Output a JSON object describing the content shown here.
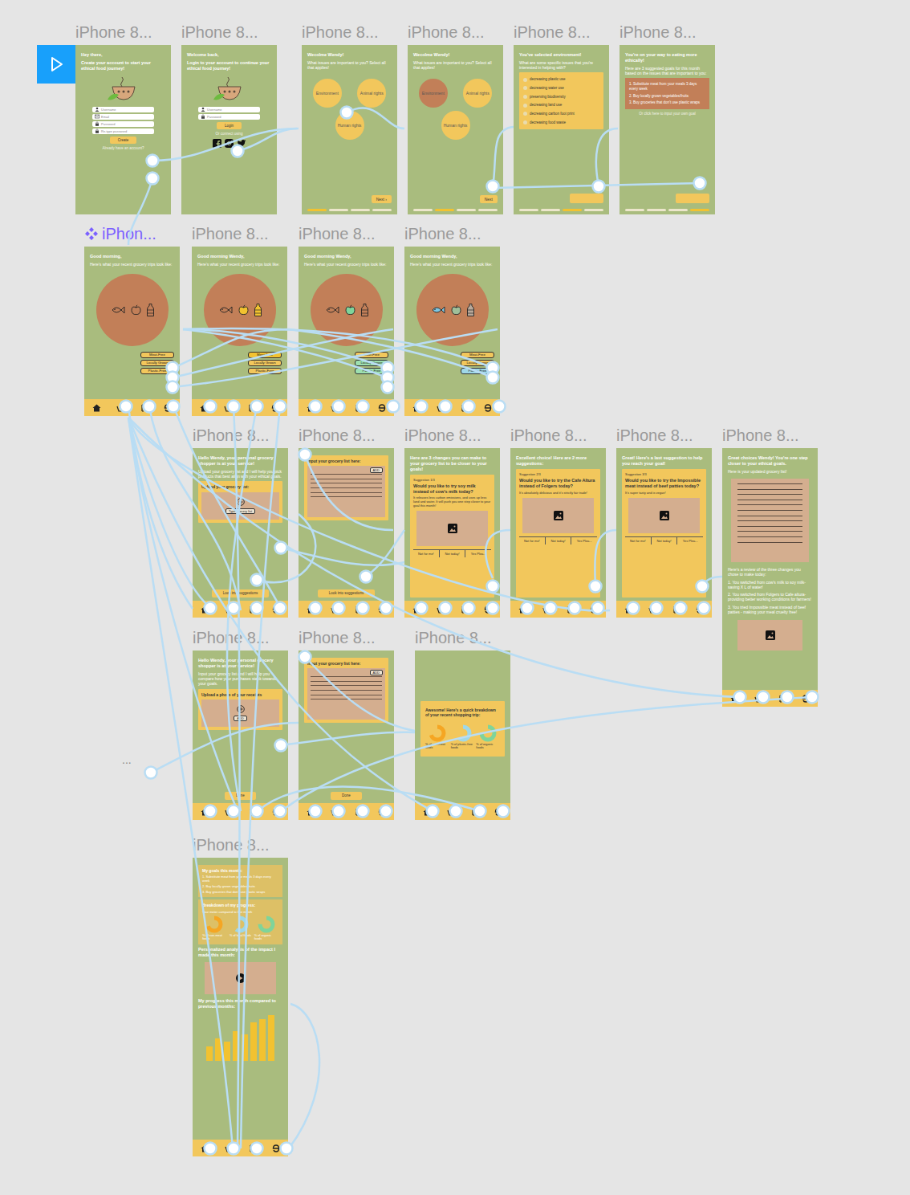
{
  "canvas": {
    "more": "..."
  },
  "frames": [
    {
      "title": "iPhone 8...",
      "component": false,
      "kind": "signup",
      "heading": "Hey there,",
      "subheading": "Create your account to start your ethical food journey!",
      "fields": [
        {
          "kind": "user",
          "placeholder": "Username"
        },
        {
          "kind": "mail",
          "placeholder": "Email"
        },
        {
          "kind": "lock",
          "placeholder": "Password"
        },
        {
          "kind": "lock",
          "placeholder": "Re-type password"
        }
      ],
      "button": "Create",
      "link": "Already have an account?"
    },
    {
      "title": "iPhone 8...",
      "component": false,
      "kind": "login",
      "heading": "Welcome back,",
      "subheading": "Login to your account to continue your ethical food journey!",
      "fields": [
        {
          "kind": "user",
          "placeholder": "Username"
        },
        {
          "kind": "lock",
          "placeholder": "Password"
        }
      ],
      "button": "Login",
      "connect": "Or connect using"
    },
    {
      "title": "iPhone 8...",
      "component": false,
      "kind": "issues",
      "heading": "Wecolme Wendy!",
      "question": "What issues are important to you? Select all that applies!",
      "issues": [
        {
          "label": "Environment",
          "selected": false
        },
        {
          "label": "Animal rights",
          "selected": false
        },
        {
          "label": "Human rights",
          "selected": false
        }
      ],
      "button": "Next",
      "chevron": "›",
      "progress": [
        {
          "selected": true
        },
        {
          "selected": false
        },
        {
          "selected": false
        },
        {
          "selected": false
        }
      ]
    },
    {
      "title": "iPhone 8...",
      "component": false,
      "kind": "issues",
      "heading": "Wecolme Wendy!",
      "question": "What issues are important to you? Select all that applies!",
      "issues": [
        {
          "label": "Environment",
          "selected": true
        },
        {
          "label": "Animal rights",
          "selected": false
        },
        {
          "label": "Human rights",
          "selected": false
        }
      ],
      "button": "Next",
      "chevron": "",
      "progress": [
        {
          "selected": false
        },
        {
          "selected": true
        },
        {
          "selected": false
        },
        {
          "selected": false
        }
      ]
    },
    {
      "title": "iPhone 8...",
      "component": false,
      "kind": "checklist",
      "heading": "You've selected environment!",
      "question": "What are some specific issues that you're interested in helping with?",
      "items": [
        {
          "label": "decreasing plastic use",
          "checked": false
        },
        {
          "label": "decreasing water use",
          "checked": false
        },
        {
          "label": "preserving biodiversity",
          "checked": false
        },
        {
          "label": "decreasing land use",
          "checked": false
        },
        {
          "label": "decreasing carbon foot print",
          "checked": false
        },
        {
          "label": "decreasing food waste",
          "checked": false
        }
      ],
      "progress": [
        {
          "selected": false
        },
        {
          "selected": false
        },
        {
          "selected": true
        },
        {
          "selected": false
        }
      ]
    },
    {
      "title": "iPhone 8...",
      "component": false,
      "kind": "goals",
      "heading": "You're on your way to eating more ethically!",
      "intro": "Here are 3 suggested goals for this month based on the issues that are important to you:",
      "goals": [
        "1. Substitute meat from your meals 3 days every week",
        "2. Buy locally grown vegetables/fruits",
        "3. Buy groceries that don't use plastic wraps"
      ],
      "note": "Or click here to input your own goal",
      "progress": [
        {
          "selected": false
        },
        {
          "selected": false
        },
        {
          "selected": false
        },
        {
          "selected": true
        }
      ]
    },
    {
      "title": "iPhon...",
      "component": true,
      "kind": "home",
      "greeting": "Good morning,",
      "subtitle": "Here's what your recent grocery trips look like:",
      "foods": [
        {
          "kind": "fish",
          "color": "#c27f58"
        },
        {
          "kind": "apple",
          "color": "#c27f58"
        },
        {
          "kind": "bottle",
          "color": "#c27f58"
        }
      ],
      "filters": [
        {
          "label": "Meat-Free",
          "color": "#f2c75c"
        },
        {
          "label": "Locally Grown",
          "color": "#f2c75c"
        },
        {
          "label": "Plastic-Free",
          "color": "#f2c75c"
        }
      ]
    },
    {
      "title": "iPhone 8...",
      "component": false,
      "kind": "home",
      "greeting": "Good morning Wendy,",
      "subtitle": "Here's what your recent grocery trips look like:",
      "foods": [
        {
          "kind": "fish",
          "color": "#c27f58"
        },
        {
          "kind": "apple",
          "color": "#f2c230"
        },
        {
          "kind": "bottle",
          "color": "#f2c230"
        }
      ],
      "filters": [
        {
          "label": "Meat-Free",
          "color": "#f2c230"
        },
        {
          "label": "Locally Grown",
          "color": "#f2c75c"
        },
        {
          "label": "Plastic-Free",
          "color": "#f2c75c"
        }
      ]
    },
    {
      "title": "iPhone 8...",
      "component": false,
      "kind": "home",
      "greeting": "Good morning Wendy,",
      "subtitle": "Here's what your recent grocery trips look like:",
      "foods": [
        {
          "kind": "fish",
          "color": "#c27f58"
        },
        {
          "kind": "apple",
          "color": "#7fd49a"
        },
        {
          "kind": "bottle",
          "color": "#c27f58"
        }
      ],
      "filters": [
        {
          "label": "Meat-Free",
          "color": "#f2c75c"
        },
        {
          "label": "Locally Grown",
          "color": "#9de0b0"
        },
        {
          "label": "Plastic-Free",
          "color": "#9de0b0"
        }
      ]
    },
    {
      "title": "iPhone 8...",
      "component": false,
      "kind": "home",
      "greeting": "Good morning Wendy,",
      "subtitle": "Here's what your recent grocery trips look like:",
      "foods": [
        {
          "kind": "fish",
          "color": "#7ec8e3"
        },
        {
          "kind": "apple",
          "color": "#9fbf9a"
        },
        {
          "kind": "bottle",
          "color": "#b9a99a"
        }
      ],
      "filters": [
        {
          "label": "Meat-Free",
          "color": "#f2c75c"
        },
        {
          "label": "Locally Grown",
          "color": "#f2c75c"
        },
        {
          "label": "Plastic-Free",
          "color": "#9fd8e8"
        }
      ]
    },
    {
      "title": "iPhone 8...",
      "component": false,
      "kind": "upload",
      "intro": "Hello Wendy, your personal grocery shopper is at your service!",
      "body": "Upload your grocery list and I will help you pick products that best align with your ethical goals.",
      "card": "Upload your grocery list:",
      "drop": "Type grocery list",
      "button": "Look into suggestions"
    },
    {
      "title": "iPhone 8...",
      "component": false,
      "kind": "input",
      "card": "Input your grocery list here:",
      "add": "ADD",
      "button": "Look into suggestions"
    },
    {
      "title": "iPhone 8...",
      "component": false,
      "kind": "suggestion",
      "intro": "Here are 3 changes you can make to your grocery list to be closer to your goals!",
      "label": "Suggestion 1/3",
      "question": "Would you like to try soy milk instead of cow's milk today?",
      "detail": "It releases less carbon emissions, and uses up less land and water. It will push you one step closer to your goal this month!",
      "choices": [
        "Not for me!",
        "Not today!",
        "Yes Plea..."
      ]
    },
    {
      "title": "iPhone 8...",
      "component": false,
      "kind": "suggestion",
      "intro": "Excellent choice! Here are 2 more suggestions:",
      "label": "Suggestion 2/3",
      "question": "Would you like to try the Cafe Altura instead of Folgers today?",
      "detail": "It's absolutely delicious and it's strictly fair trade!",
      "choices": [
        "Not for me!",
        "Not today!",
        "Yes Plea..."
      ]
    },
    {
      "title": "iPhone 8...",
      "component": false,
      "kind": "suggestion",
      "intro": "Great! Here's a last suggestion to help you reach your goal!",
      "label": "Suggestion 3/3",
      "question": "Would you like to try the Impossible meat instead of beef patties today?",
      "detail": "It's super tasty and is vegan!",
      "choices": [
        "Not for me!",
        "Not today!",
        "Yes Plea..."
      ]
    },
    {
      "title": "iPhone 8...",
      "component": false,
      "kind": "summary",
      "intro": "Great choices Wendy! You're one step closer to your ethical goals.",
      "sub": "Here is your updated grocery list!",
      "review": "Here's a review of the three changes you chose to make today:",
      "changes": [
        "1. You switched from cow's milk to soy milk- saving X L of water!",
        "2. You switched from Folgers to Cafe altura- providing better working conditions for farmers!",
        "3. You tried Impossible meat instead of beef patties - making your meal cruelty free!"
      ]
    },
    {
      "title": "iPhone 8...",
      "component": false,
      "kind": "upload",
      "intro": "Hello Wendy, your personal grocery shopper is at your service!",
      "body": "Input your grocery list and I will help you compare how your purchases stack towards your goals.",
      "card": "Upload a photo of your receipts",
      "drop": "ADD",
      "button": "Done"
    },
    {
      "title": "iPhone 8...",
      "component": false,
      "kind": "input",
      "card": "Input your grocery list here:",
      "add": "ADD",
      "button": "Done"
    },
    {
      "title": "iPhone 8...",
      "component": false,
      "kind": "breakdown",
      "heading": "Awesome! Here's a quick breakdown of your recent shopping trip:",
      "donuts": [
        {
          "label": "% of non-meat foods",
          "level": 0.7,
          "color": "#f5a623"
        },
        {
          "label": "% of plastic-free foods",
          "level": 0.6,
          "color": "#9fd8e8"
        },
        {
          "label": "% of organic foods",
          "level": 0.75,
          "color": "#7fd49a"
        }
      ]
    },
    {
      "title": "iPhone 8...",
      "component": false,
      "kind": "dashboard",
      "goalsTitle": "My goals this month:",
      "goals": [
        "1. Substitute meat from your meals 3 days every week",
        "2. Buy locally grown vegetables/fruits",
        "3. Buy groceries that don't use plastic wraps"
      ],
      "progressTitle": "Breakdown of my progress:",
      "progressNote": "Your meter compared to last month",
      "donuts": [
        {
          "label": "% of non-meat foods",
          "level": 0.7,
          "color": "#f5a623"
        },
        {
          "label": "% of local foods",
          "level": 0.6,
          "color": "#9fd8e8"
        },
        {
          "label": "% of organic foods",
          "level": 0.75,
          "color": "#7fd49a"
        }
      ],
      "analysisTitle": "Personalized analysis of the impact I made this month:",
      "chartTitle": "My progress this month compared to previous months:",
      "bars": [
        30,
        48,
        40,
        62,
        55,
        80,
        88,
        95
      ]
    }
  ]
}
